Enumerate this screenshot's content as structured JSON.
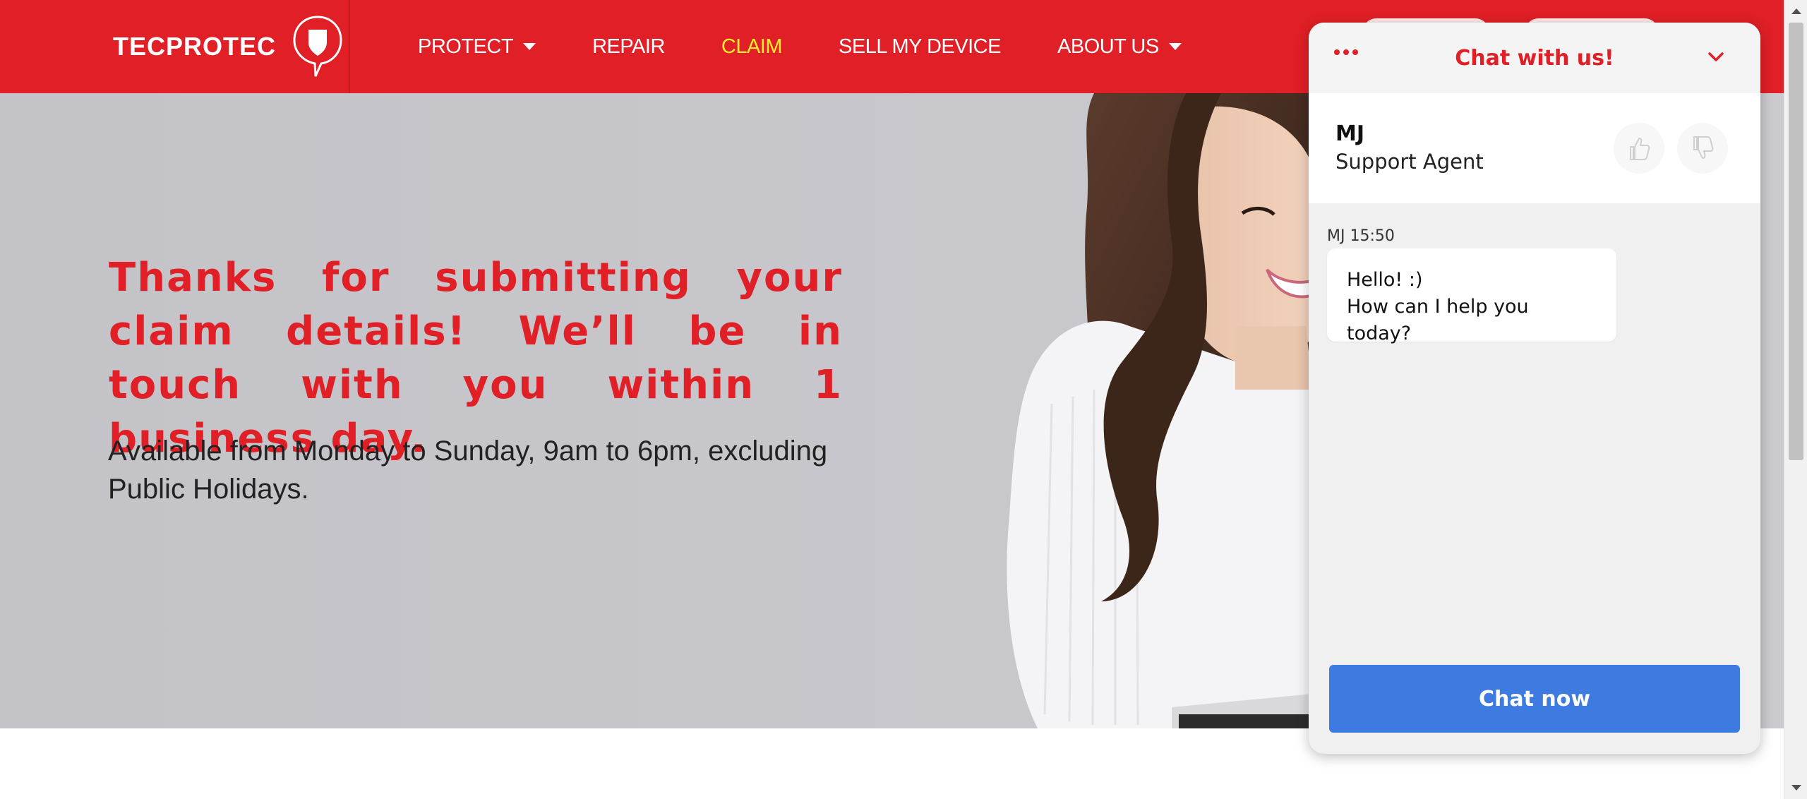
{
  "brand": {
    "logo_text": "TECPROTEC",
    "primary_color": "#e01f26",
    "active_nav_color": "#ffec2a"
  },
  "nav": {
    "items": [
      {
        "label": "PROTECT",
        "has_dropdown": true
      },
      {
        "label": "REPAIR",
        "has_dropdown": false
      },
      {
        "label": "CLAIM",
        "has_dropdown": false,
        "active": true
      },
      {
        "label": "SELL MY DEVICE",
        "has_dropdown": false
      },
      {
        "label": "ABOUT US",
        "has_dropdown": true
      }
    ]
  },
  "hero": {
    "headline": "Thanks for submitting your claim details! We’ll be in touch with you within 1 business day.",
    "subtext": "Available from Monday to Sunday, 9am to 6pm, excluding Public Holidays."
  },
  "chat": {
    "title": "Chat with us!",
    "agent": {
      "name": "MJ",
      "role": "Support Agent"
    },
    "messages": [
      {
        "meta": "MJ 15:50",
        "line1": "Hello! :)",
        "line2": "How can I help you today?"
      }
    ],
    "cta_label": "Chat now",
    "cta_color": "#3d7be0"
  }
}
